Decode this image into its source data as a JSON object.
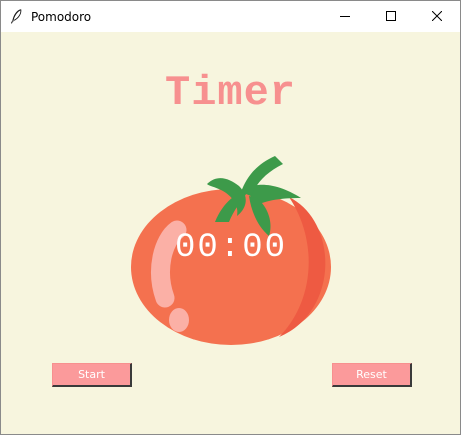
{
  "window": {
    "title": "Pomodoro",
    "icon": "feather-icon",
    "controls": [
      "minimize-icon",
      "maximize-icon",
      "close-icon"
    ]
  },
  "main": {
    "title": "Timer",
    "countdown": "00:00",
    "illustration": "tomato-icon"
  },
  "buttons": {
    "start_label": "Start",
    "reset_label": "Reset"
  },
  "colors": {
    "background": "#f7f5de",
    "title_text": "#f7908f",
    "button_bg": "#fb9a9b",
    "tomato": "#f26b4e",
    "leaf": "#3d9a4a",
    "countdown_text": "#ffffff"
  }
}
